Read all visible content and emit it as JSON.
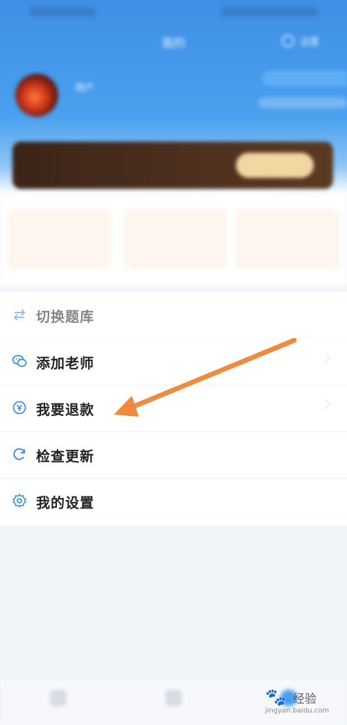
{
  "nav": {
    "title": "我的",
    "right_label": "设置"
  },
  "user": {
    "name": "用户",
    "sub": ""
  },
  "vip": {
    "text": "",
    "button": ""
  },
  "cards": [
    {
      "title": "",
      "sub": ""
    },
    {
      "title": "",
      "sub": ""
    },
    {
      "title": "",
      "sub": ""
    }
  ],
  "menu": {
    "items": [
      {
        "icon": "swap-icon",
        "label": "切换题库",
        "right": ""
      },
      {
        "icon": "wechat-icon",
        "label": "添加老师",
        "right": ""
      },
      {
        "icon": "refund-icon",
        "label": "我要退款",
        "right": ""
      },
      {
        "icon": "refresh-icon",
        "label": "检查更新",
        "right": ""
      },
      {
        "icon": "gear-icon",
        "label": "我的设置",
        "right": ""
      }
    ]
  },
  "annotation": {
    "arrow_color": "#f08a3c",
    "target": "我要退款"
  },
  "tabbar": {
    "tabs": [
      {
        "label": ""
      },
      {
        "label": ""
      },
      {
        "label": ""
      }
    ]
  },
  "watermark": {
    "brand": "经验",
    "url": "jingyan.baidu.com"
  },
  "colors": {
    "primary": "#4aa0ef",
    "icon_blue": "#3d8fe0",
    "vip_gold": "#f3d7a2"
  }
}
